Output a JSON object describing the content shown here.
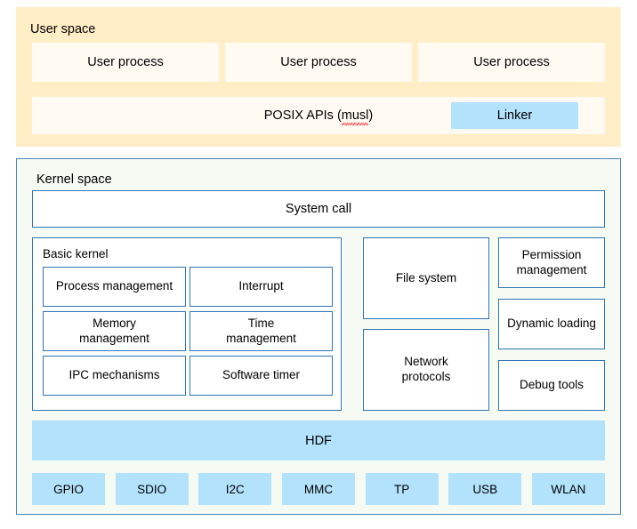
{
  "user_space": {
    "title": "User space",
    "processes": [
      {
        "label": "User process"
      },
      {
        "label": "User process"
      },
      {
        "label": "User process"
      }
    ],
    "posix": {
      "prefix": "POSIX APIs (",
      "misspelled_word": "musl",
      "suffix": ")",
      "full_label": "POSIX APIs (musl)"
    },
    "linker": {
      "label": "Linker"
    }
  },
  "kernel_space": {
    "title": "Kernel space",
    "system_call": {
      "label": "System call"
    },
    "basic_kernel": {
      "title": "Basic kernel",
      "items": [
        {
          "label": "Process management"
        },
        {
          "label": "Interrupt"
        },
        {
          "label": "Memory\nmanagement"
        },
        {
          "label": "Time\nmanagement"
        },
        {
          "label": "IPC mechanisms"
        },
        {
          "label": "Software timer"
        }
      ]
    },
    "middle_column": [
      {
        "label": "File system"
      },
      {
        "label": "Network\nprotocols"
      }
    ],
    "right_column": [
      {
        "label": "Permission\nmanagement"
      },
      {
        "label": "Dynamic loading"
      },
      {
        "label": "Debug tools"
      }
    ],
    "hdf": {
      "label": "HDF"
    },
    "drivers": [
      {
        "label": "GPIO"
      },
      {
        "label": "SDIO"
      },
      {
        "label": "I2C"
      },
      {
        "label": "MMC"
      },
      {
        "label": "TP"
      },
      {
        "label": "USB"
      },
      {
        "label": "WLAN"
      }
    ]
  },
  "colors": {
    "user_space_bg": "#ffeec6",
    "user_box_bg": "#fffbf3",
    "kernel_space_bg": "#f5faf3",
    "kernel_border": "#4a86b8",
    "box_border": "#2e75b6",
    "highlight_blue": "#b2e2fc",
    "spellcheck_red": "#e8252a",
    "text": "#000000"
  }
}
